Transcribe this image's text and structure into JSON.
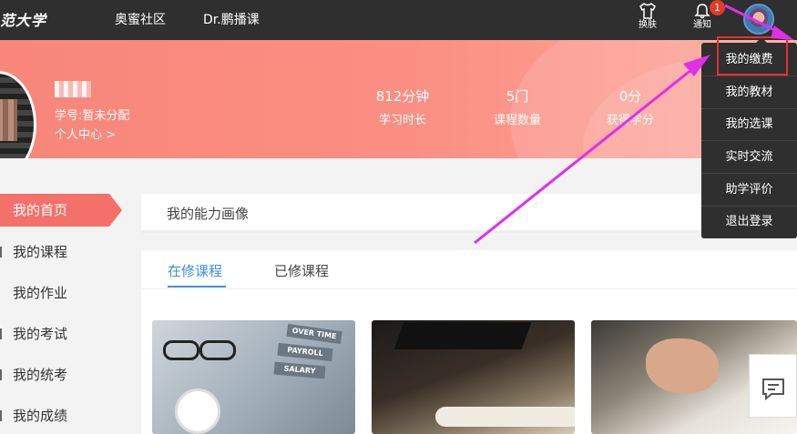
{
  "topbar": {
    "logo": "范大学",
    "nav": [
      "奥蜜社区",
      "Dr.鹏播课"
    ],
    "skin_label": "换肤",
    "notify_label": "通知",
    "notify_count": "1"
  },
  "banner": {
    "student_id": "学号:暂未分配",
    "personal_center": "个人中心 >",
    "stats": [
      {
        "value": "812分钟",
        "label": "学习时长"
      },
      {
        "value": "5门",
        "label": "课程数量"
      },
      {
        "value": "0分",
        "label": "获得学分"
      }
    ]
  },
  "dropdown": {
    "items": [
      "我的缴费",
      "我的教材",
      "我的选课",
      "实时交流",
      "助学评价",
      "退出登录"
    ]
  },
  "sidebar": {
    "items": [
      "我的首页",
      "我的课程",
      "我的作业",
      "我的考试",
      "我的统考",
      "我的成绩"
    ]
  },
  "main": {
    "ability_title": "我的能力画像",
    "tabs": [
      "在修课程",
      "已修课程"
    ]
  },
  "course_images": {
    "folder_labels": [
      "OVER TIME",
      "PAYROLL",
      "SALARY"
    ]
  },
  "colors": {
    "accent": "#3f8fd9",
    "banner": "#f8867a",
    "highlight_box": "#e8312e",
    "annotation_arrow": "#e02fe8"
  }
}
